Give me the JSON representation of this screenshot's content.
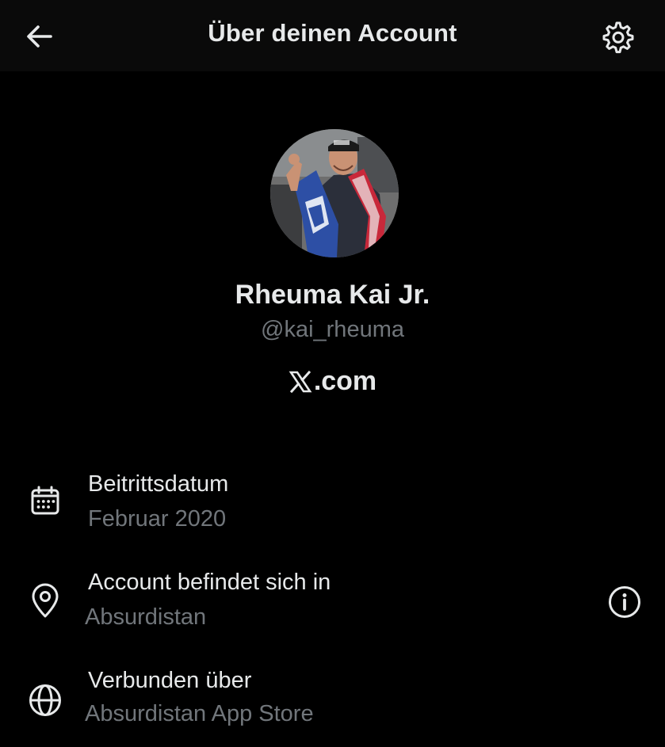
{
  "header": {
    "title": "Über deinen Account",
    "back_icon": "arrow-left-icon",
    "settings_icon": "gear-icon"
  },
  "profile": {
    "avatar": "avatar",
    "display_name": "Rheuma Kai Jr.",
    "handle": "@kai_rheuma",
    "platform_logo": "X",
    "platform_suffix": ".com"
  },
  "details": [
    {
      "icon": "calendar-icon",
      "title": "Beitrittsdatum",
      "value": "Februar 2020"
    },
    {
      "icon": "location-pin-icon",
      "title": "Account befindet sich in",
      "value": "Absurdistan",
      "action_icon": "info-icon"
    },
    {
      "icon": "globe-icon",
      "title": "Verbunden über",
      "value": "Absurdistan App Store"
    }
  ],
  "colors": {
    "background": "#000000",
    "header_background": "#0a0a0a",
    "primary_text": "#e7e9ea",
    "secondary_text": "#71767b"
  }
}
